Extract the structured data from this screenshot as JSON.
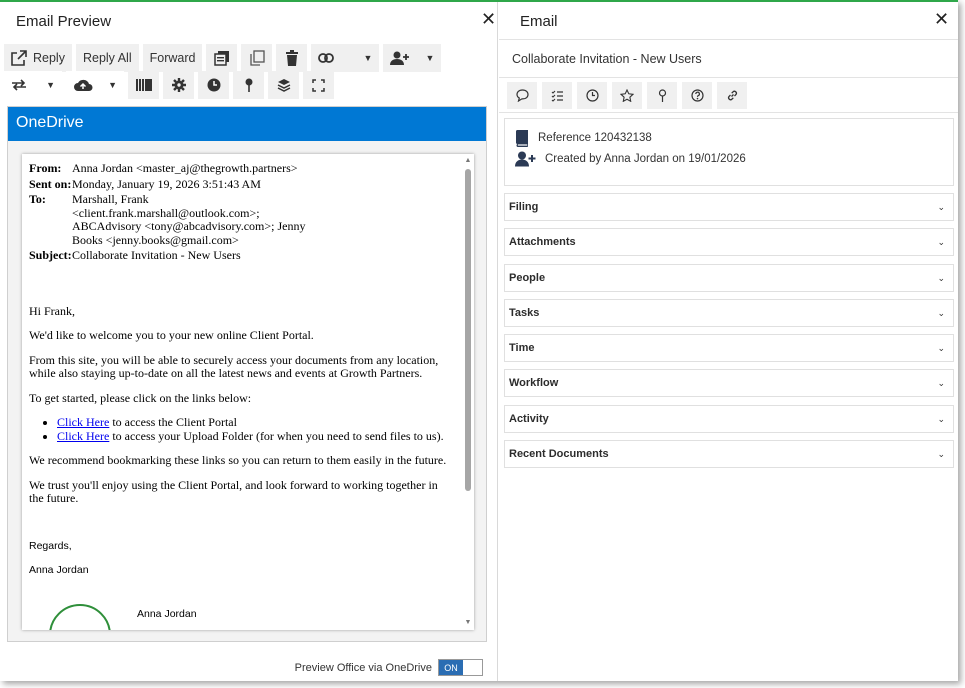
{
  "left_pane": {
    "title": "Email Preview",
    "toolbar": {
      "reply_label": "Reply",
      "reply_all_label": "Reply All",
      "forward_label": "Forward"
    },
    "onedrive_header": "OneDrive",
    "toggle_label": "Preview Office via OneDrive",
    "toggle_state": "ON"
  },
  "email": {
    "from_key": "From:",
    "from": "Anna Jordan <master_aj@thegrowth.partners>",
    "sent_key": "Sent on:",
    "sent": "Monday, January 19, 2026 3:51:43 AM",
    "to_key": "To:",
    "to": "Marshall, Frank <client.frank.marshall@outlook.com>; ABCAdvisory <tony@abcadvisory.com>; Jenny Books <jenny.books@gmail.com>",
    "subject_key": "Subject:",
    "subject": "Collaborate Invitation - New Users",
    "greeting": "Hi Frank,",
    "p1": "We'd like to welcome you to your new online Client Portal.",
    "p2": "From this site, you will be able to securely access your documents from any location, while also staying up-to-date on all the latest news and events at Growth Partners.",
    "p3": "To get started, please click on the links below:",
    "link1_text": "Click Here",
    "link1_rest": " to access the Client Portal",
    "link2_text": "Click Here",
    "link2_rest": " to access your Upload Folder (for when you need to send files to us).",
    "p4": "We recommend bookmarking these links so you can return to them easily in the future.",
    "p5": "We trust you'll enjoy using the Client Portal, and look forward to working together in the future.",
    "regards": "Regards,",
    "sign_name": "Anna Jordan",
    "sig_block_name": "Anna Jordan"
  },
  "right_pane": {
    "title": "Email",
    "subject": "Collaborate Invitation - New Users",
    "reference": "Reference 120432138",
    "created": "Created by Anna Jordan on 19/01/2026",
    "sections": [
      "Filing",
      "Attachments",
      "People",
      "Tasks",
      "Time",
      "Workflow",
      "Activity",
      "Recent Documents"
    ]
  },
  "colors": {
    "onedrive_blue": "#0078d4",
    "toggle_on": "#2a6db3",
    "frame_accent": "#2fa74a"
  },
  "icons": {
    "left_toolbar": [
      "reply-icon",
      "copy-icon",
      "duplicate-icon",
      "delete-icon",
      "link-icon",
      "add-user-icon",
      "transfer-icon",
      "cloud-upload-icon",
      "library-icon",
      "gear-icon",
      "clock-icon",
      "pin-icon",
      "layers-icon",
      "fullscreen-icon"
    ],
    "right_toolbar": [
      "comment-icon",
      "tasklist-icon",
      "clock-icon",
      "star-icon",
      "pin-icon",
      "help-icon",
      "link-icon"
    ]
  }
}
